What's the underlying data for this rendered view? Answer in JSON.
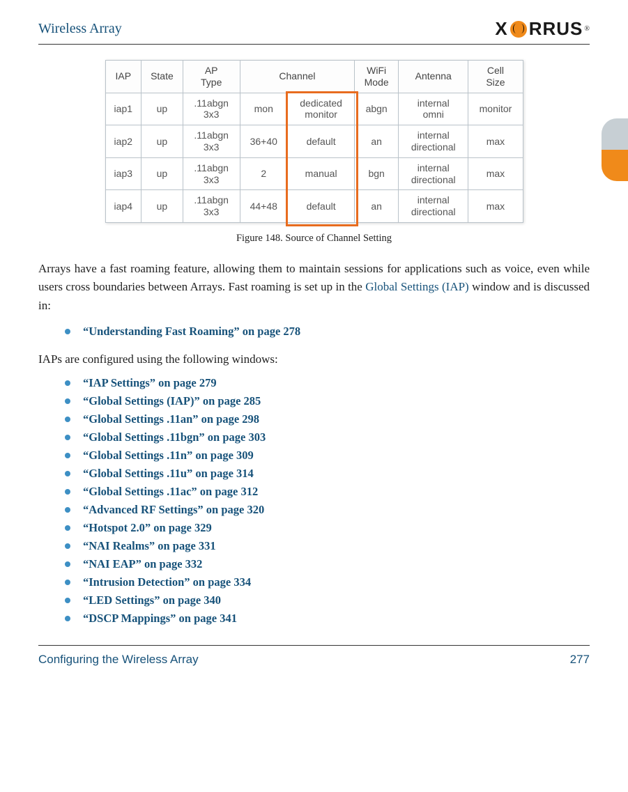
{
  "header": {
    "title": "Wireless Array",
    "logo_left": "X",
    "logo_right": "RRUS",
    "logo_reg": "®"
  },
  "figure": {
    "caption": "Figure 148. Source of Channel Setting",
    "headers": [
      "IAP",
      "State",
      "AP Type",
      "Channel",
      "",
      "WiFi Mode",
      "Antenna",
      "Cell Size"
    ],
    "header_iap": "IAP",
    "header_state": "State",
    "header_aptype": "AP\nType",
    "header_channel": "Channel",
    "header_wifi": "WiFi\nMode",
    "header_antenna": "Antenna",
    "header_cell": "Cell\nSize",
    "rows": [
      {
        "iap": "iap1",
        "state": "up",
        "aptype": ".11abgn\n3x3",
        "ch1": "mon",
        "ch2": "dedicated\nmonitor",
        "wifi": "abgn",
        "ant": "internal\nomni",
        "cell": "monitor"
      },
      {
        "iap": "iap2",
        "state": "up",
        "aptype": ".11abgn\n3x3",
        "ch1": "36+40",
        "ch2": "default",
        "wifi": "an",
        "ant": "internal\ndirectional",
        "cell": "max"
      },
      {
        "iap": "iap3",
        "state": "up",
        "aptype": ".11abgn\n3x3",
        "ch1": "2",
        "ch2": "manual",
        "wifi": "bgn",
        "ant": "internal\ndirectional",
        "cell": "max"
      },
      {
        "iap": "iap4",
        "state": "up",
        "aptype": ".11abgn\n3x3",
        "ch1": "44+48",
        "ch2": "default",
        "wifi": "an",
        "ant": "internal\ndirectional",
        "cell": "max"
      }
    ]
  },
  "paragraph1_a": "Arrays have a fast roaming feature, allowing them to maintain sessions for applications such as voice, even while users cross boundaries between Arrays. Fast roaming is set up in the ",
  "paragraph1_link": "Global Settings (IAP)",
  "paragraph1_b": " window and is discussed in:",
  "single_link": "“Understanding Fast Roaming” on page 278",
  "paragraph2": "IAPs are configured using the following windows:",
  "links": [
    "“IAP Settings” on page 279",
    "“Global Settings (IAP)” on page 285",
    "“Global Settings .11an” on page 298",
    "“Global Settings .11bgn” on page 303",
    "“Global Settings .11n” on page 309",
    "“Global Settings .11u” on page 314",
    "“Global Settings .11ac” on page 312",
    "“Advanced RF Settings” on page 320",
    "“Hotspot 2.0” on page 329",
    "“NAI Realms” on page 331",
    "“NAI EAP” on page 332",
    "“Intrusion Detection” on page 334",
    "“LED Settings” on page 340",
    "“DSCP Mappings” on page 341"
  ],
  "footer": {
    "section": "Configuring the Wireless Array",
    "page": "277"
  }
}
